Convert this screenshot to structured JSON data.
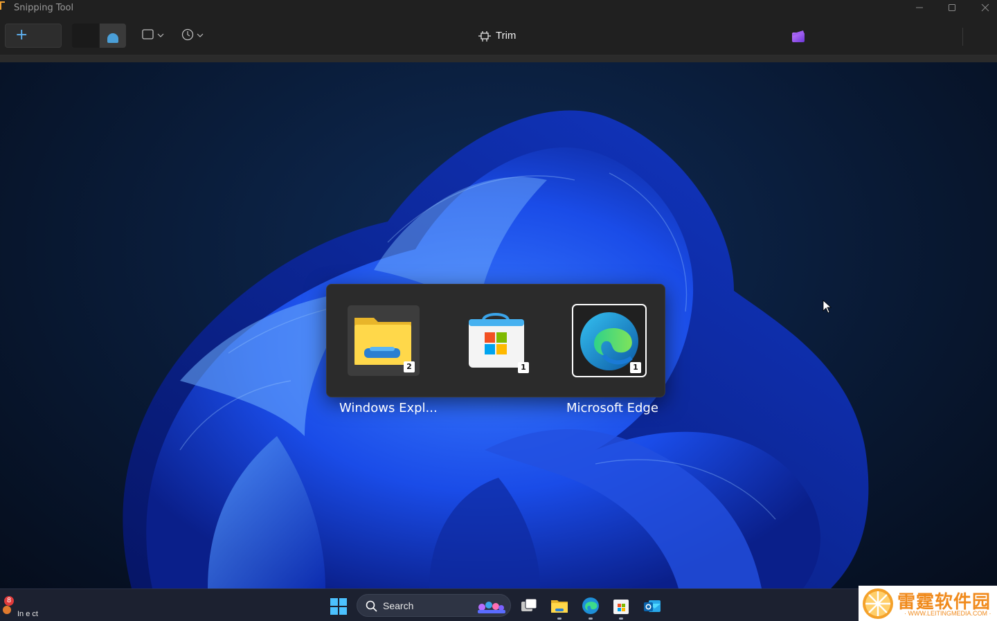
{
  "window": {
    "title": "Snipping Tool",
    "accent": "#5fb2f2"
  },
  "toolbar": {
    "new_label": "+",
    "trim_label": "Trim",
    "icons": [
      "new-snip-icon",
      "photo-mode-icon",
      "video-mode-icon",
      "rectangle-shape-icon",
      "timer-icon",
      "trim-icon",
      "clipchamp-icon"
    ]
  },
  "switcher": {
    "items": [
      {
        "label": "Windows Expl...",
        "badge": "2",
        "icon": "file-explorer-icon",
        "selected": false
      },
      {
        "label": "",
        "badge": "1",
        "icon": "microsoft-store-icon",
        "selected": false
      },
      {
        "label": "Microsoft Edge",
        "badge": "1",
        "icon": "edge-icon",
        "selected": true
      }
    ]
  },
  "taskbar": {
    "weather_badge": "8",
    "weather_text": "In e  ct",
    "search_label": "Search",
    "apps": [
      "start-icon",
      "search-icon",
      "task-view-icon",
      "file-explorer-icon",
      "edge-icon",
      "microsoft-store-icon",
      "outlook-icon"
    ]
  },
  "watermark": {
    "title": "雷霆软件园",
    "subtitle": "· WWW.LEITINGMEDIA.COM ·"
  }
}
